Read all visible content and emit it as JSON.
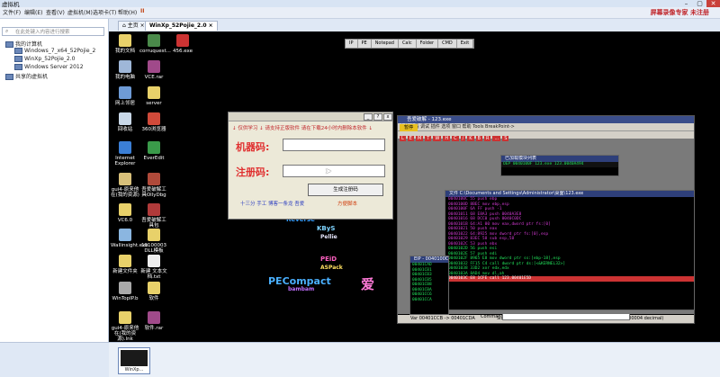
{
  "window": {
    "title": "虚拟机",
    "controls": [
      "–",
      "▢",
      "✕"
    ]
  },
  "menubar": {
    "items": [
      "文件(F)",
      "编辑(E)",
      "查看(V)",
      "虚拟机(M)",
      "选项卡(T)",
      "帮助(H)"
    ],
    "power_label": "II",
    "warning": "屏幕录像专家 未注册"
  },
  "library": {
    "search_placeholder": "在此处键入内容进行搜索",
    "root": "我的计算机",
    "vms": [
      "Windows_7_x64_52Pojie_2",
      "WinXp_52Pojie_2.0",
      "Windows Server 2012"
    ],
    "shared": "共享的虚拟机"
  },
  "tabs": [
    {
      "label": "主页"
    },
    {
      "label": "WinXp_52Pojie_2.0"
    }
  ],
  "tab_close": "×",
  "desktop": {
    "icons": [
      {
        "label": "我的文档",
        "color": "#e8d16a"
      },
      {
        "label": "我的电脑",
        "color": "#9fb7d8"
      },
      {
        "label": "网上邻居",
        "color": "#6e9bd6"
      },
      {
        "label": "回收站",
        "color": "#c9d8e8"
      },
      {
        "label": "Internet Explorer",
        "color": "#3b7fd6"
      },
      {
        "label": "gui4-原来他在(我的资源)",
        "color": "#d8c07a"
      },
      {
        "label": "VC6.0",
        "color": "#e8d16a"
      },
      {
        "label": "Wallinsight.exe",
        "color": "#8bb6e0"
      },
      {
        "label": "新建文件夹",
        "color": "#e8d16a"
      },
      {
        "label": "WinTopIP.b",
        "color": "#aaaaaa"
      },
      {
        "label": "gui4-原来他在(我的资源).lnk",
        "color": "#e8d16a"
      },
      {
        "label": "corruquest...",
        "color": "#4a8a4a"
      },
      {
        "label": "VCE.rar",
        "color": "#a04a8a"
      },
      {
        "label": "server",
        "color": "#e8d16a"
      },
      {
        "label": "360浏览器",
        "color": "#d04a3a"
      },
      {
        "label": "EverEdit",
        "color": "#3a9a4a"
      },
      {
        "label": "吾爱破解工具OllyDbg",
        "color": "#b04a3a"
      },
      {
        "label": "吾爱破解工具包",
        "color": "#b03a3a"
      },
      {
        "label": "19100003 DLL模板",
        "color": "#e8d16a"
      },
      {
        "label": "新建 文本文档.txt",
        "color": "#eeeeee"
      },
      {
        "label": "软件",
        "color": "#e8d16a"
      },
      {
        "label": "软件.rar",
        "color": "#a04a8a"
      },
      {
        "label": "456.exe",
        "color": "#cc3333"
      }
    ],
    "vm_toolbar": [
      "IP",
      "PE",
      "Notepad",
      "Calc",
      "Folder",
      "CMD",
      "Exit"
    ],
    "graffiti_words": [
      "Reverse",
      "KByS",
      "Pellie",
      "PECompact",
      "bambam",
      "PEiD",
      "ASPack",
      "爱"
    ]
  },
  "keygen": {
    "title_line": "↓ 仅供学习 ↓ 请支持正版软件 请在下载24小时内删除本软件 ↓",
    "machine_label": "机器码:",
    "register_label": "注册码:",
    "machine_value": "",
    "register_value": "",
    "generate_button": "生成注册码",
    "links": "十三分  手工  博客一条龙  吾爱",
    "author": "方便脚本"
  },
  "debugger": {
    "title": "吾爱破解 - 123.exe",
    "menu": "文件 查看 调试 插件 选项 窗口 帮助 Tools BreakPoint->",
    "sub_title": "已加载模块列表",
    "sub_line": "OEP 0040100F  123.exe 123.0040A494",
    "cpu_title": "文件 C:\\Documents and Settings\\Administrator\\桌面\\123.exe",
    "code_lines": [
      "0040100C  55       push ebp",
      "0040100D  8BEC     mov ebp,esp",
      "0040100F  6A FF    push -1",
      "00401011  68 E8A3  push 0040A3E8",
      "00401016  68 DCC0  push 0040C0DC",
      "0040101B  64:A1 00 mov eax,dword ptr fs:[0]",
      "00401021  50       push eax",
      "00401022  64:8925  mov dword ptr fs:[0],esp",
      "00401029  83EC 58  sub esp,58",
      "0040102C  53       push ebx",
      "0040102D  56       push esi",
      "0040102E  57       push edi",
      "0040102F  8965 E8  mov dword ptr ss:[ebp-18],esp",
      "00401032  FF15 C4  call dword ptr ds:[<&KERNEL32>]",
      "00401038  33D2     xor edx,edx",
      "0040103A  8AD4     mov dl,ah",
      "0040103C  E8 1CFE  call 123.00401E5D"
    ],
    "mini_title": "EIP - 0040100C",
    "mini_lines": [
      "00401CAD",
      "00401CB1",
      "00401CB3",
      "00401CB5",
      "00401CB8",
      "00401CBA",
      "00401CC6",
      "00401CCA"
    ],
    "status_left": "Var 00401CCB -> 00401CDA",
    "status_mid": "Size: (0x0011 = 00017 bytes)",
    "status_right": "(0x0004 = 00004 decimal)",
    "command_label": "Command",
    "toolbar_letters": [
      "L",
      "E",
      "M",
      "T",
      "W",
      "H",
      "C",
      "/",
      "K",
      "B",
      "R",
      "...",
      "S"
    ],
    "colors": {
      "accent": "#c0262b",
      "code_green": "#22e05a",
      "code_pink": "#d23ad2"
    }
  },
  "thumbnail": {
    "label": "WinXp..."
  }
}
